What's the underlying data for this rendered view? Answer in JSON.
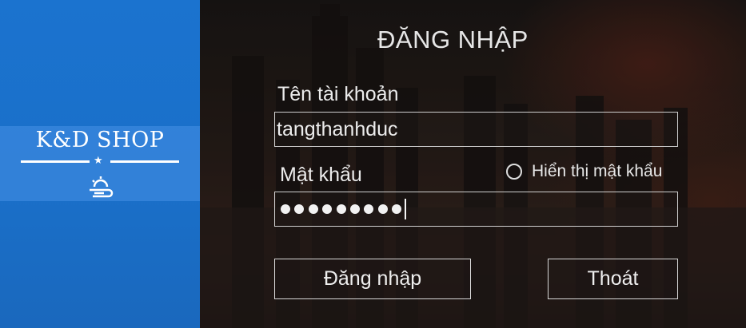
{
  "brand": {
    "name": "K&D SHOP",
    "icon": "weather-sun-wind-icon",
    "color": "#1b73cf"
  },
  "form": {
    "title": "ĐĂNG NHẬP",
    "username_label": "Tên tài khoản",
    "username_value": "tangthanhduc",
    "password_label": "Mật khẩu",
    "password_length": 9,
    "show_password_label": "Hiển thị mật khẩu",
    "show_password_checked": false,
    "login_button": "Đăng nhập",
    "exit_button": "Thoát"
  }
}
